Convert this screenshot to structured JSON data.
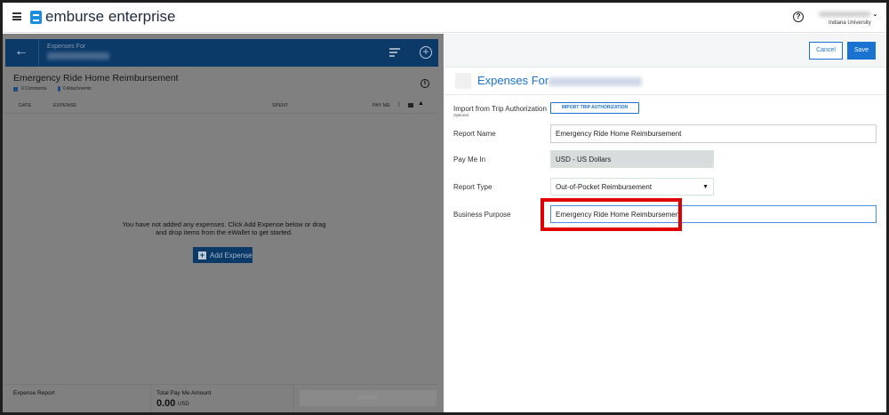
{
  "app": {
    "brand": "emburse enterprise",
    "org": "Indiana University"
  },
  "left": {
    "header_title": "Expenses For",
    "report_title": "Emergency Ride Home Reimbursement",
    "comments": "0 Comments",
    "attachments": "0 Attachments",
    "columns": [
      "DATE",
      "EXPENSE",
      "SPENT",
      "PAY ME"
    ],
    "empty_message": "You have not added any expenses. Click Add Expense below or drag and drop items from the eWallet to get started.",
    "add_expense": "Add Expense",
    "footer": {
      "report_label": "Expense Report",
      "total_label": "Total Pay Me Amount",
      "total_value": "0.00",
      "currency": "USD",
      "submit": "Submit"
    }
  },
  "right": {
    "cancel": "Cancel",
    "save": "Save",
    "title": "Expenses For",
    "form": {
      "import_label": "Import from Trip Authorization",
      "import_sub": "Optional",
      "import_button": "IMPORT TRIP AUTHORIZATION",
      "report_name_label": "Report Name",
      "report_name": "Emergency Ride Home Reimbursement",
      "pay_me_in_label": "Pay Me In",
      "pay_me_in": "USD - US Dollars",
      "report_type_label": "Report Type",
      "report_type": "Out-of-Pocket Reimbursement",
      "business_purpose_label": "Business Purpose",
      "business_purpose": "Emergency Ride Home Reimbursement"
    }
  },
  "colors": {
    "accent": "#1a73d1",
    "header_blue": "#0b3a69",
    "highlight": "#e00000"
  }
}
